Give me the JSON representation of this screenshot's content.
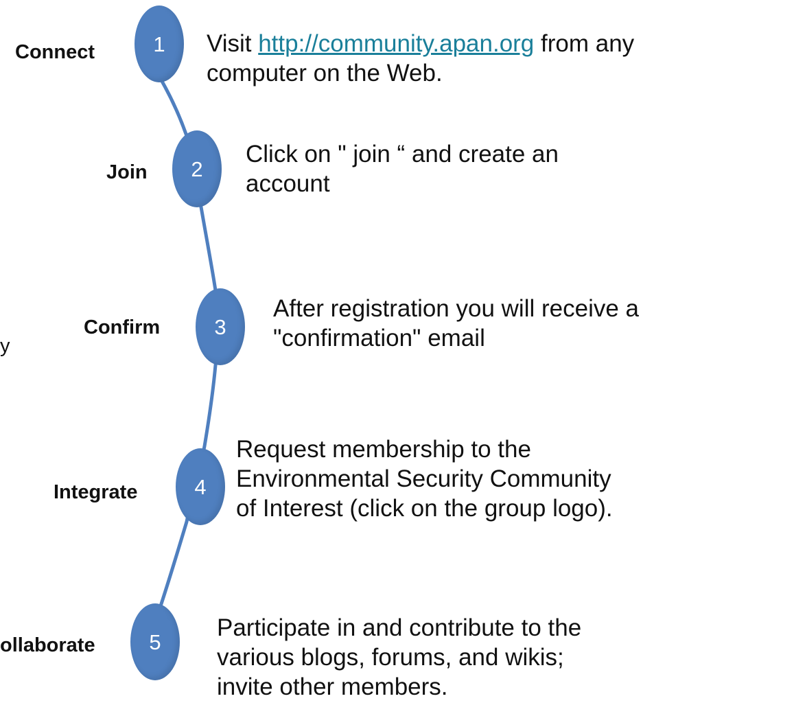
{
  "colors": {
    "node_fill": "#4f7fbf",
    "node_text": "#ffffff",
    "connector": "#4f7fbf",
    "link": "#1a7f9a",
    "text": "#111111"
  },
  "stray_text": "y",
  "steps": [
    {
      "number": "1",
      "label": "Connect",
      "desc_prefix": "Visit ",
      "link_text": "http://community.apan.org",
      "desc_suffix": " from any",
      "desc_line2": "computer on the Web."
    },
    {
      "number": "2",
      "label": "Join",
      "desc_line1": "Click on \" join “ and  create an",
      "desc_line2": "account"
    },
    {
      "number": "3",
      "label": "Confirm",
      "desc_line1": "After registration you will receive a",
      "desc_line2": "\"confirmation\" email"
    },
    {
      "number": "4",
      "label": "Integrate",
      "desc_line1": "Request membership to the",
      "desc_line2": "Environmental Security Community",
      "desc_line3": "of Interest  (click on the group logo)."
    },
    {
      "number": "5",
      "label": "ollaborate",
      "desc_line1": "Participate in and contribute to the",
      "desc_line2": "various blogs, forums, and wikis;",
      "desc_line3": "invite other members."
    }
  ]
}
